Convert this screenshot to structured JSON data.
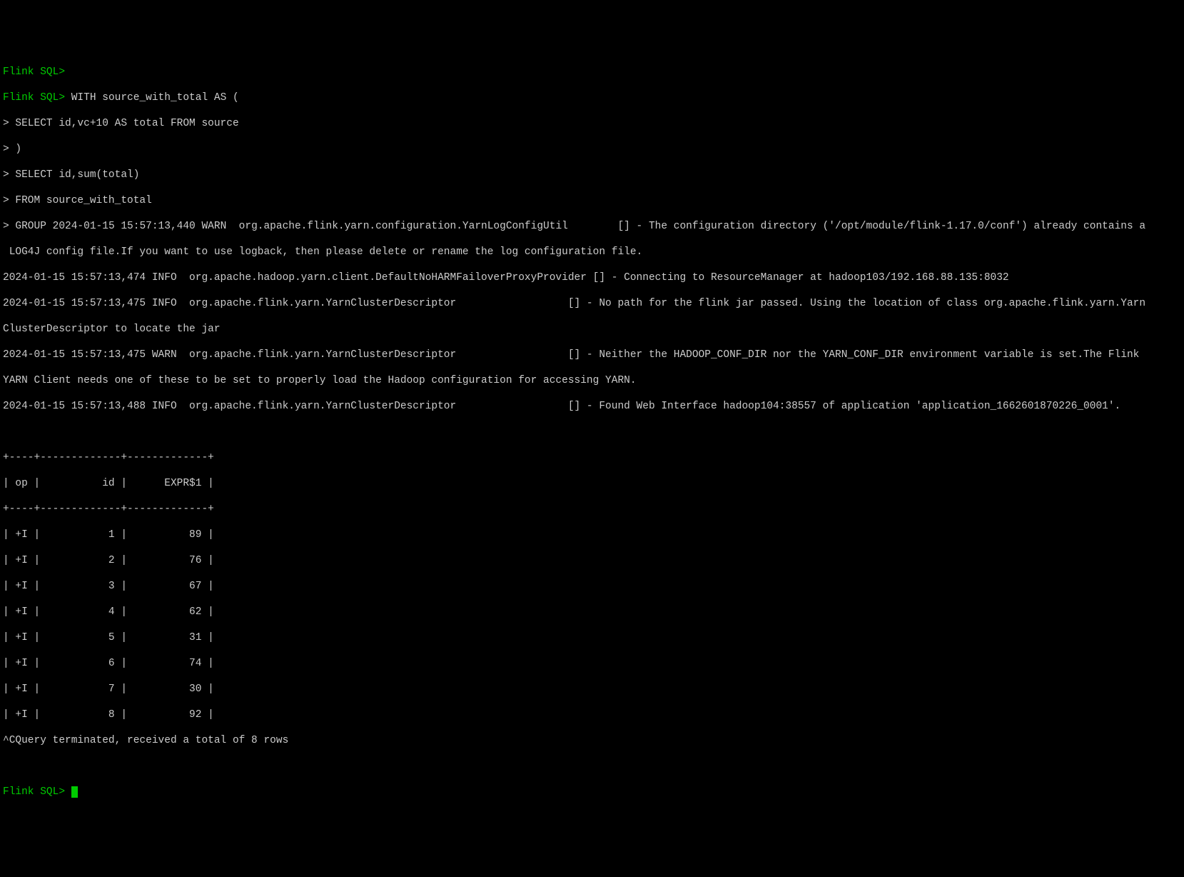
{
  "prompt_label": "Flink SQL",
  "prompt_suffix": ">",
  "continuation_prompt": ">",
  "sql_lines": [
    "WITH source_with_total AS (",
    "SELECT id,vc+10 AS total FROM source",
    ")",
    "SELECT id,sum(total)",
    "FROM source_with_total"
  ],
  "group_prefix": "GROUP ",
  "log_lines": [
    "2024-01-15 15:57:13,440 WARN  org.apache.flink.yarn.configuration.YarnLogConfigUtil        [] - The configuration directory ('/opt/module/flink-1.17.0/conf') already contains a",
    " LOG4J config file.If you want to use logback, then please delete or rename the log configuration file.",
    "2024-01-15 15:57:13,474 INFO  org.apache.hadoop.yarn.client.DefaultNoHARMFailoverProxyProvider [] - Connecting to ResourceManager at hadoop103/192.168.88.135:8032",
    "2024-01-15 15:57:13,475 INFO  org.apache.flink.yarn.YarnClusterDescriptor                  [] - No path for the flink jar passed. Using the location of class org.apache.flink.yarn.Yarn",
    "ClusterDescriptor to locate the jar",
    "2024-01-15 15:57:13,475 WARN  org.apache.flink.yarn.YarnClusterDescriptor                  [] - Neither the HADOOP_CONF_DIR nor the YARN_CONF_DIR environment variable is set.The Flink ",
    "YARN Client needs one of these to be set to properly load the Hadoop configuration for accessing YARN.",
    "2024-01-15 15:57:13,488 INFO  org.apache.flink.yarn.YarnClusterDescriptor                  [] - Found Web Interface hadoop104:38557 of application 'application_1662601870226_0001'."
  ],
  "table_border_top": "+----+-------------+-------------+",
  "table_header": "| op |          id |      EXPR$1 |",
  "table_border_mid": "+----+-------------+-------------+",
  "table_rows": [
    "| +I |           1 |          89 |",
    "| +I |           2 |          76 |",
    "| +I |           3 |          67 |",
    "| +I |           4 |          62 |",
    "| +I |           5 |          31 |",
    "| +I |           6 |          74 |",
    "| +I |           7 |          30 |",
    "| +I |           8 |          92 |"
  ],
  "termination_line": "^CQuery terminated, received a total of 8 rows",
  "chart_data": {
    "type": "table",
    "title": "",
    "columns": [
      "op",
      "id",
      "EXPR$1"
    ],
    "rows": [
      [
        "+I",
        1,
        89
      ],
      [
        "+I",
        2,
        76
      ],
      [
        "+I",
        3,
        67
      ],
      [
        "+I",
        4,
        62
      ],
      [
        "+I",
        5,
        31
      ],
      [
        "+I",
        6,
        74
      ],
      [
        "+I",
        7,
        30
      ],
      [
        "+I",
        8,
        92
      ]
    ]
  }
}
